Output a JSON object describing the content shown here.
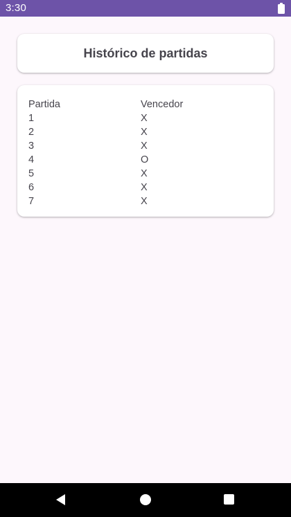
{
  "status_bar": {
    "time": "3:30",
    "battery_icon": "battery-full-icon",
    "background_color": "#6d53a8"
  },
  "header": {
    "title": "Histórico de partidas"
  },
  "history": {
    "columns": [
      "Partida",
      "Vencedor"
    ],
    "rows": [
      [
        "1",
        "X"
      ],
      [
        "2",
        "X"
      ],
      [
        "3",
        "X"
      ],
      [
        "4",
        "O"
      ],
      [
        "5",
        "X"
      ],
      [
        "6",
        "X"
      ],
      [
        "7",
        "X"
      ]
    ]
  },
  "nav_bar": {
    "icons": [
      "back-icon",
      "home-icon",
      "recents-icon"
    ]
  },
  "colors": {
    "background": "#fdf7fc",
    "card": "#ffffff",
    "text": "#46444c"
  }
}
